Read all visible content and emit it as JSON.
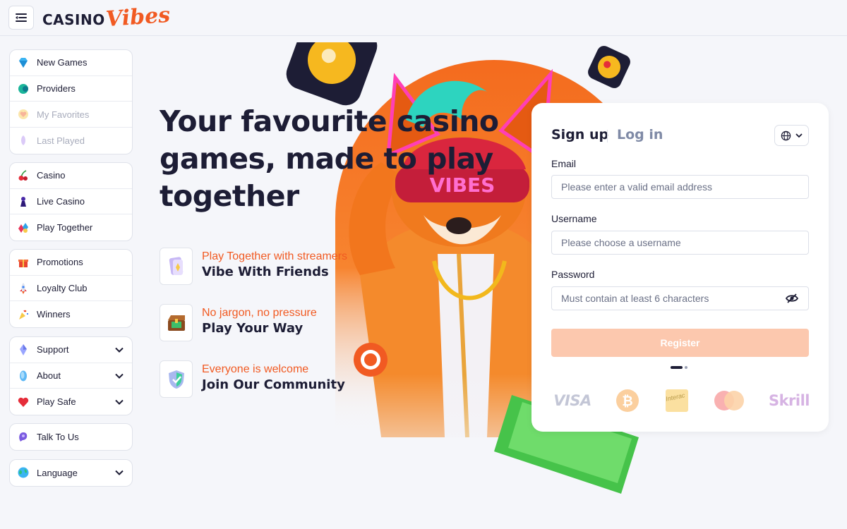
{
  "header": {
    "logo_casino": "CASINO",
    "logo_vibes": "Vibes"
  },
  "sidebar": {
    "group1": [
      {
        "label": "New Games",
        "icon": "gem-icon",
        "dim": false
      },
      {
        "label": "Providers",
        "icon": "providers-icon",
        "dim": false
      },
      {
        "label": "My Favorites",
        "icon": "heart-icon",
        "dim": true
      },
      {
        "label": "Last Played",
        "icon": "history-icon",
        "dim": true
      }
    ],
    "group2": [
      {
        "label": "Casino",
        "icon": "cherry-icon"
      },
      {
        "label": "Live Casino",
        "icon": "chess-pawn-icon"
      },
      {
        "label": "Play Together",
        "icon": "multiplayer-icon"
      }
    ],
    "group3": [
      {
        "label": "Promotions",
        "icon": "gift-icon"
      },
      {
        "label": "Loyalty Club",
        "icon": "rocket-icon"
      },
      {
        "label": "Winners",
        "icon": "confetti-icon"
      }
    ],
    "group4": [
      {
        "label": "Support",
        "icon": "support-icon"
      },
      {
        "label": "About",
        "icon": "info-icon"
      },
      {
        "label": "Play Safe",
        "icon": "heart-shield-icon"
      }
    ],
    "talk": "Talk To Us",
    "language": "Language"
  },
  "hero": {
    "title_line1": "Your favourite casino",
    "title_line2": "games, made to play",
    "title_line3": "together",
    "features": [
      {
        "tagline": "Play Together with streamers",
        "heading": "Vibe With Friends"
      },
      {
        "tagline": "No jargon, no pressure",
        "heading": "Play Your Way"
      },
      {
        "tagline": "Everyone is welcome",
        "heading": "Join Our Community"
      }
    ]
  },
  "form": {
    "tab_signup": "Sign up",
    "tab_login": "Log in",
    "email_label": "Email",
    "email_placeholder": "Please enter a valid email address",
    "username_label": "Username",
    "username_placeholder": "Please choose a username",
    "password_label": "Password",
    "password_placeholder": "Must contain at least 6 characters",
    "register_label": "Register",
    "payments": {
      "visa": "VISA",
      "interac": "Interac",
      "skrill": "Skrill"
    }
  },
  "colors": {
    "accent": "#f15a22",
    "text": "#1d1d35",
    "register_disabled": "#fcc8ae"
  }
}
